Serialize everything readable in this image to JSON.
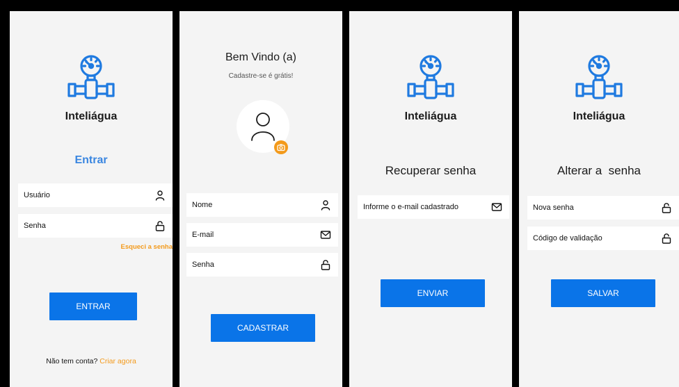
{
  "login": {
    "brand": "Inteliágua",
    "title": "Entrar",
    "user_label": "Usuário",
    "password_label": "Senha",
    "forgot": "Esqueci a senha",
    "button": "ENTRAR",
    "no_account": "Não tem conta?",
    "create": "Criar agora"
  },
  "register": {
    "title": "Bem Vindo (a)",
    "subtitle": "Cadastre-se é grátis!",
    "name_label": "Nome",
    "email_label": "E-mail",
    "password_label": "Senha",
    "button": "CADASTRAR"
  },
  "recover": {
    "brand": "Inteliágua",
    "title": "Recuperar senha",
    "email_label": "Informe o e-mail cadastrado",
    "button": "ENVIAR"
  },
  "change": {
    "brand": "Inteliágua",
    "title": "Alterar a  senha",
    "new_password_label": "Nova senha",
    "code_label": "Código de validação",
    "button": "SALVAR"
  },
  "colors": {
    "primary": "#0a74e8",
    "accent": "#f39a1b",
    "logo": "#1f7ae0",
    "background": "#f4f4f4"
  },
  "icons": {
    "logo": "water-meter-pipe-icon",
    "user": "user-icon",
    "lock": "lock-icon",
    "mail": "mail-icon",
    "camera": "camera-icon",
    "avatar": "avatar-icon"
  }
}
